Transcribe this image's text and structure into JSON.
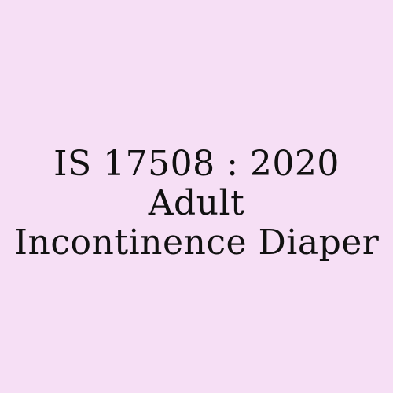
{
  "background_color": "#f6dff5",
  "text_color": "#111111",
  "title": {
    "line1": "IS 17508 : 2020",
    "line2": "Adult",
    "line3": "Incontinence Diaper"
  }
}
